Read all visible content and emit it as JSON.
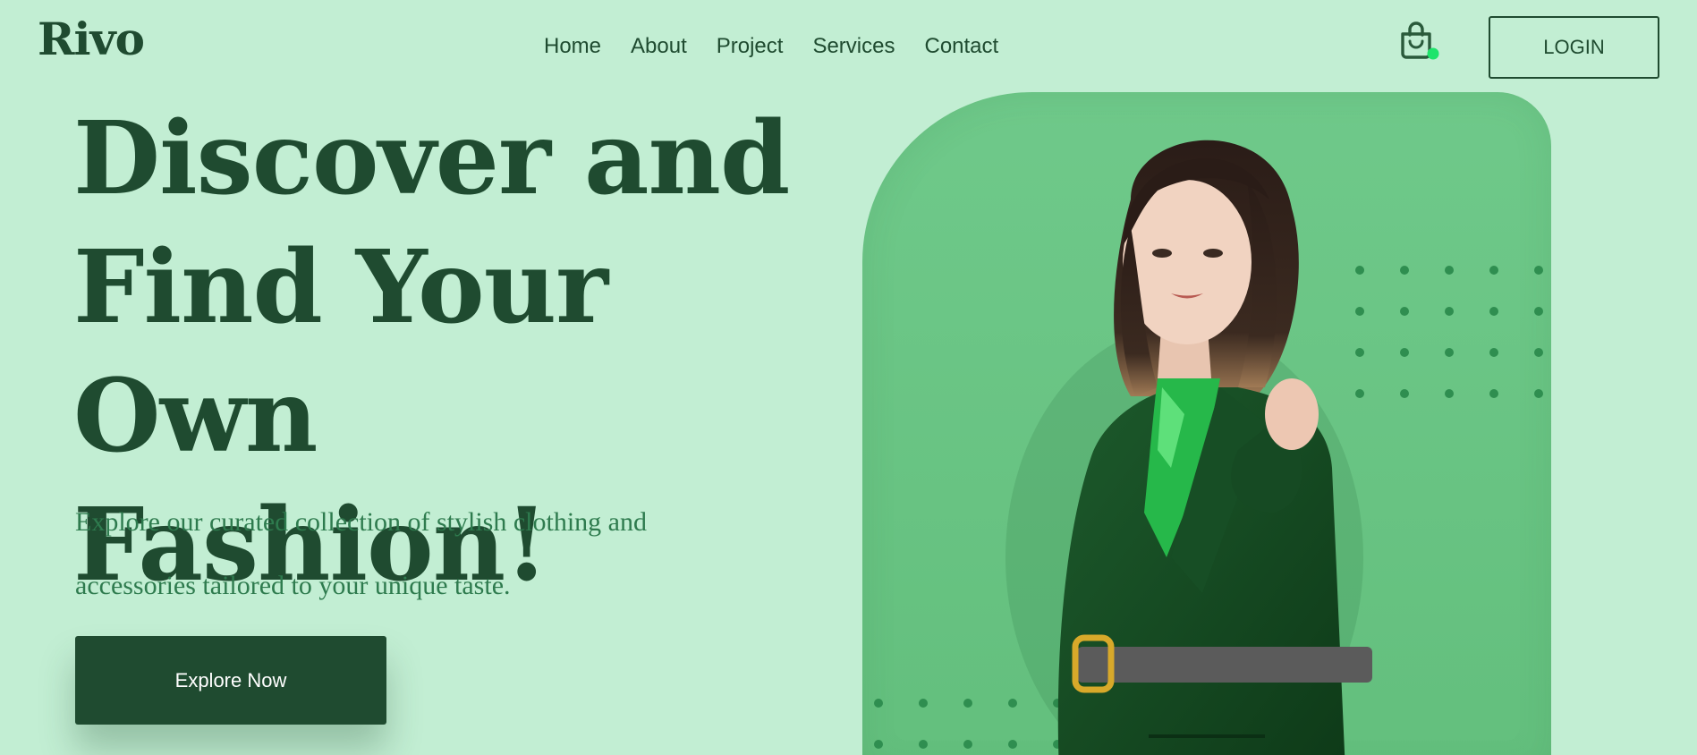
{
  "header": {
    "logo": "Rivo",
    "nav": [
      "Home",
      "About",
      "Project",
      "Services",
      "Contact"
    ],
    "cart_icon": "shopping-bag-icon",
    "cart_badge_color": "#1fe46b",
    "login_label": "LOGIN"
  },
  "hero": {
    "title_lines": [
      "Discover and",
      "Find Your Own",
      "Fashion!"
    ],
    "subtitle_lines": [
      "Explore our curated collection of stylish clothing and",
      "accessories tailored to your unique taste."
    ],
    "cta_label": "Explore Now"
  },
  "colors": {
    "background": "#c2eed3",
    "primary": "#1f4b30",
    "subtitle": "#2e7b4e",
    "panel": "#6fc98a"
  }
}
